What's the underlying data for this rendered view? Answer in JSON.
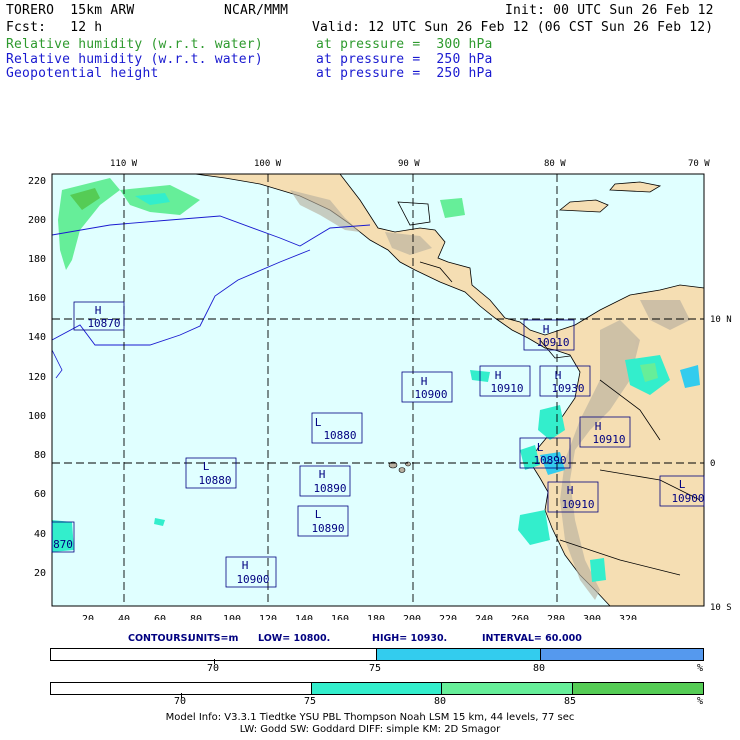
{
  "header": {
    "model": "TORERO  15km ARW",
    "org": "NCAR/MMM",
    "init": "Init: 00 UTC Sun 26 Feb 12",
    "fcst": "Fcst:   12 h",
    "valid": "Valid: 12 UTC Sun 26 Feb 12 (06 CST Sun 26 Feb 12)",
    "fields": [
      {
        "name": "Relative humidity (w.r.t. water)",
        "level": "at pressure =  300 hPa",
        "color": "#2e9a2e"
      },
      {
        "name": "Relative humidity (w.r.t. water)",
        "level": "at pressure =  250 hPa",
        "color": "#1a1ad0"
      },
      {
        "name": "Geopotential height",
        "level": "at pressure =  250 hPa",
        "color": "#1a1ad0"
      }
    ]
  },
  "map": {
    "top_lon_labels": [
      "110 W",
      "100 W",
      "90 W",
      "80 W",
      "70 W"
    ],
    "right_lat_labels": [
      "10 N",
      "0",
      "10 S"
    ],
    "x_ticks": [
      "20",
      "40",
      "60",
      "80",
      "100",
      "120",
      "140",
      "160",
      "180",
      "200",
      "220",
      "240",
      "260",
      "280",
      "300",
      "320"
    ],
    "y_ticks": [
      "20",
      "40",
      "60",
      "80",
      "100",
      "120",
      "140",
      "160",
      "180",
      "200",
      "220"
    ],
    "ocean_color": "#e0ffff",
    "land_color": "#f5deb3",
    "pressure_centers": [
      {
        "type": "H",
        "value": "10870"
      },
      {
        "type": "H",
        "value": "10910"
      },
      {
        "type": "H",
        "value": "10900"
      },
      {
        "type": "H",
        "value": "10910"
      },
      {
        "type": "H",
        "value": "10930"
      },
      {
        "type": "L",
        "value": "10880"
      },
      {
        "type": "H",
        "value": "10910"
      },
      {
        "type": "L",
        "value": "10890"
      },
      {
        "type": "L",
        "value": "10880"
      },
      {
        "type": "H",
        "value": "10890"
      },
      {
        "type": "H",
        "value": "10910"
      },
      {
        "type": "L",
        "value": "10900"
      },
      {
        "type": "L",
        "value": "10890"
      },
      {
        "type": "",
        "value": "870"
      },
      {
        "type": "H",
        "value": "10900"
      }
    ]
  },
  "contours": {
    "label": "CONTOURS:",
    "units": "UNITS=m",
    "low": "LOW=  10800.",
    "high": "HIGH=  10930.",
    "interval": "INTERVAL=   60.000"
  },
  "colorbar_250": {
    "labels": [
      "70",
      "75",
      "80",
      "%"
    ],
    "colors": [
      "#ffffff",
      "#33ccee",
      "#5599ee"
    ]
  },
  "colorbar_300": {
    "labels": [
      "70",
      "75",
      "80",
      "85",
      "%"
    ],
    "colors": [
      "#ffffff",
      "#33eecc",
      "#66ee99",
      "#55cc55"
    ]
  },
  "footer": {
    "line1": "Model Info: V3.3.1   Tiedtke YSU PBL  Thompson    Noah LSM  15 km,   44 levels,   77 sec",
    "line2": "LW: Godd SW: Goddard DIFF: simple KM: 2D Smagor"
  }
}
